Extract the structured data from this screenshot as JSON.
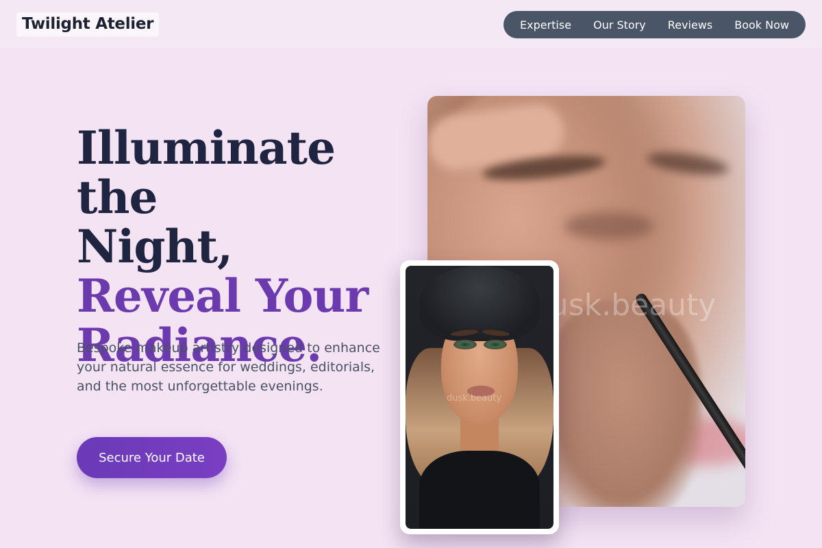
{
  "brand": {
    "name": "Twilight Atelier"
  },
  "nav": {
    "items": [
      {
        "label": "Expertise"
      },
      {
        "label": "Our Story"
      },
      {
        "label": "Reviews"
      },
      {
        "label": "Book Now"
      }
    ]
  },
  "hero": {
    "headline_line1": "Illuminate the",
    "headline_line2": "Night,",
    "headline_accent1": "Reveal Your",
    "headline_accent2": "Radiance.",
    "description": "Bespoke makeup artistry designed to enhance your natural essence for weddings, editorials, and the most unforgettable evenings.",
    "cta_label": "Secure Your Date"
  },
  "images": {
    "large_watermark": "dusk.beauty",
    "small_watermark": "dusk.beauty"
  },
  "colors": {
    "background": "#f3e3f3",
    "nav_pill": "#4a5568",
    "accent": "#6b3aaf",
    "heading": "#1f2440"
  }
}
